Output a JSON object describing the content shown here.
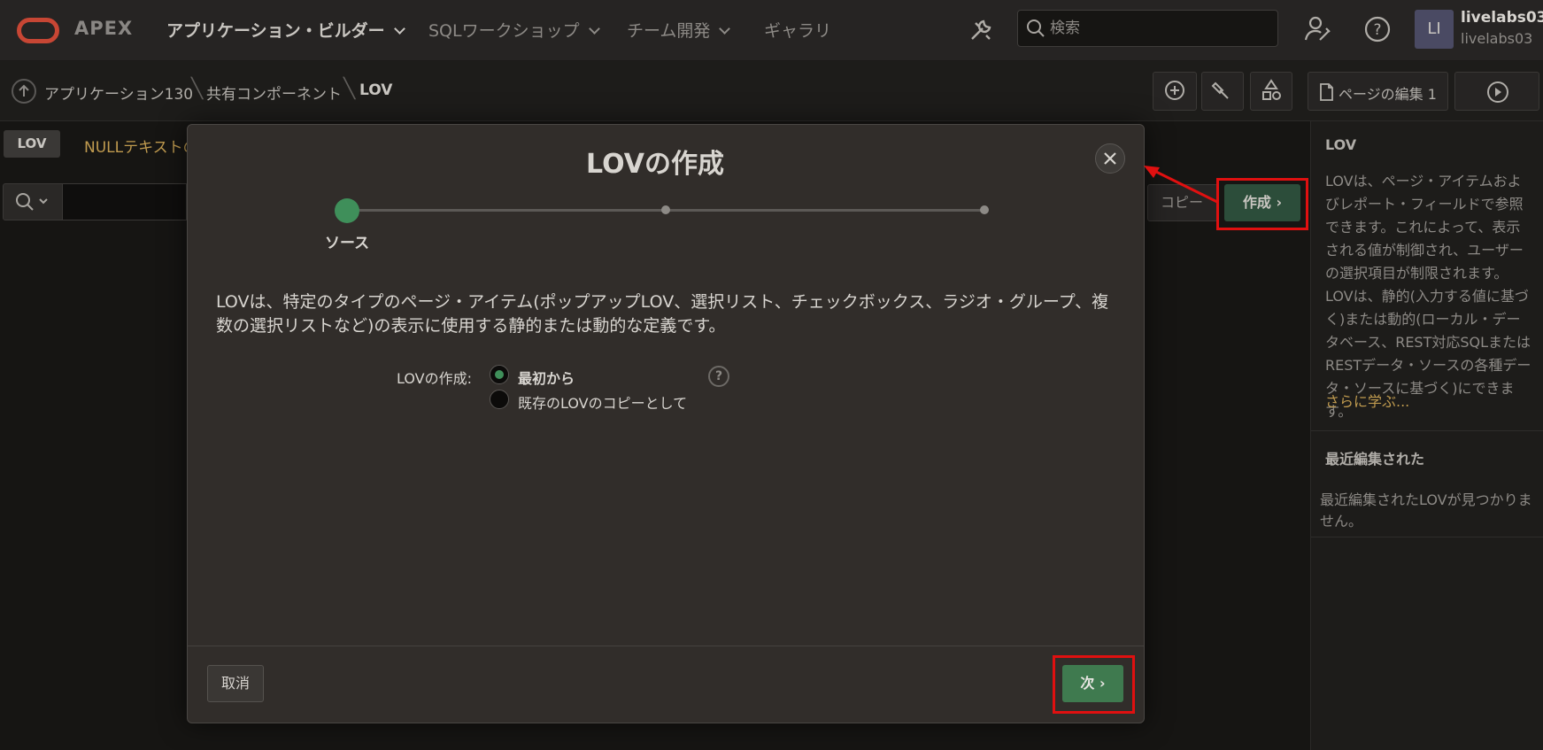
{
  "app": {
    "logo_text": "APEX"
  },
  "topnav": {
    "items": [
      {
        "label": "アプリケーション・ビルダー",
        "active": true
      },
      {
        "label": "SQLワークショップ"
      },
      {
        "label": "チーム開発"
      },
      {
        "label": "ギャラリ"
      }
    ],
    "search_placeholder": "検索",
    "user_initials": "LI",
    "user_name": "livelabs03",
    "user_workspace": "livelabs03"
  },
  "breadcrumb": {
    "items": [
      "アプリケーション130",
      "共有コンポーネント",
      "LOV"
    ],
    "edit_page_label": "ページの編集 1"
  },
  "content": {
    "tab_lov": "LOV",
    "tab_null": "NULLテキストの",
    "copy_label": "コピー",
    "create_label": "作成"
  },
  "right_panel": {
    "title": "LOV",
    "text": "LOVは、ページ・アイテムおよびレポート・フィールドで参照できます。これによって、表示される値が制御され、ユーザーの選択項目が制限されます。LOVは、静的(入力する値に基づく)または動的(ローカル・データベース、REST対応SQLまたはRESTデータ・ソースの各種データ・ソースに基づく)にできます。",
    "link": "さらに学ぶ...",
    "recent_title": "最近編集された",
    "recent_text": "最近編集されたLOVが見つかりません。"
  },
  "modal": {
    "title": "LOVの作成",
    "step_label": "ソース",
    "description": "LOVは、特定のタイプのページ・アイテム(ポップアップLOV、選択リスト、チェックボックス、ラジオ・グループ、複数の選択リストなど)の表示に使用する静的または動的な定義です。",
    "field_label": "LOVの作成:",
    "options": [
      {
        "label": "最初から",
        "selected": true
      },
      {
        "label": "既存のLOVのコピーとして",
        "selected": false
      }
    ],
    "cancel_label": "取消",
    "next_label": "次"
  },
  "colors": {
    "accent_green": "#3f8f5a",
    "highlight_red": "#e01010",
    "link_gold": "#c09b4f"
  }
}
